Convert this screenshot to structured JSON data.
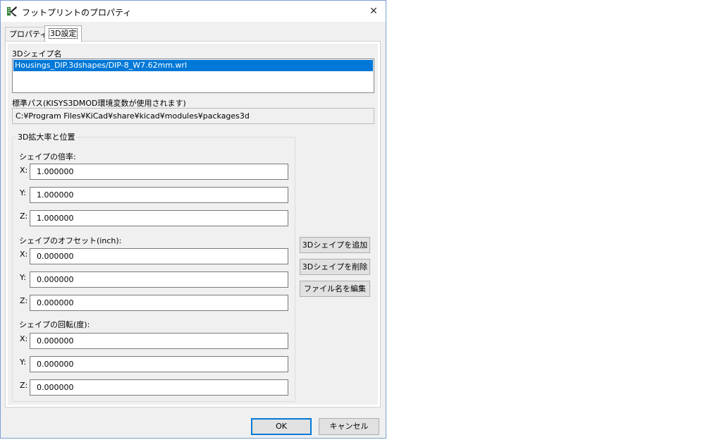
{
  "window": {
    "title": "フットプリントのプロパティ",
    "close_glyph": "✕"
  },
  "tabs": [
    {
      "label": "プロパティ"
    },
    {
      "label": "3D設定"
    }
  ],
  "shape_list": {
    "label": "3Dシェイプ名",
    "items": [
      "Housings_DIP.3dshapes/DIP-8_W7.62mm.wrl"
    ]
  },
  "default_path": {
    "label": "標準パス(KISYS3DMOD環境変数が使用されます)",
    "value": "C:¥Program Files¥KiCad¥share¥kicad¥modules¥packages3d"
  },
  "transform": {
    "group_title": "3D拡大率と位置",
    "scale": {
      "label": "シェイプの倍率:",
      "x": "1.000000",
      "y": "1.000000",
      "z": "1.000000"
    },
    "offset": {
      "label": "シェイプのオフセット(inch):",
      "x": "0.000000",
      "y": "0.000000",
      "z": "0.000000"
    },
    "rotation": {
      "label": "シェイプの回転(度):",
      "x": "0.000000",
      "y": "0.000000",
      "z": "0.000000"
    },
    "axis_labels": {
      "x": "X:",
      "y": "Y:",
      "z": "Z:"
    }
  },
  "buttons": {
    "add_shape": "3Dシェイプを追加",
    "remove_shape": "3Dシェイプを削除",
    "edit_filename": "ファイル名を編集",
    "ok": "OK",
    "cancel": "キャンセル"
  },
  "colors": {
    "selection": "#0078d7",
    "dialog_bg": "#f0f0f0",
    "default_button_border": "#0078d7"
  }
}
